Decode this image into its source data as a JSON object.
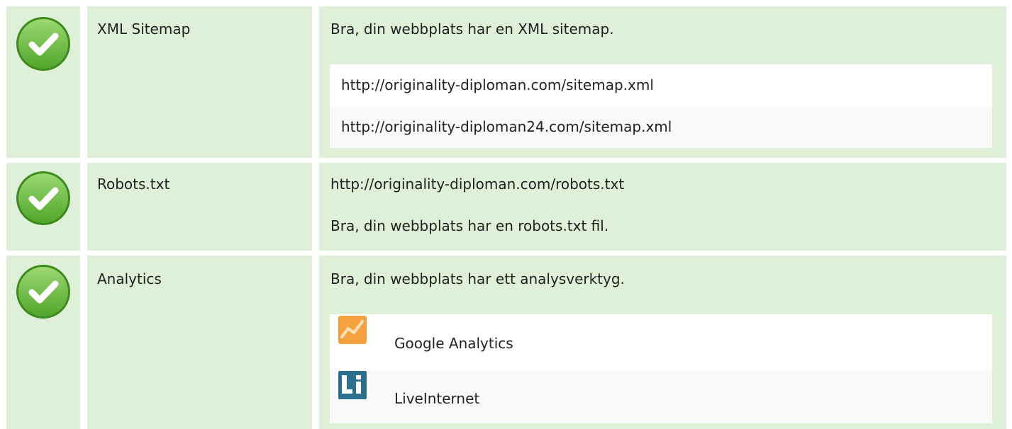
{
  "rows": [
    {
      "label": "XML Sitemap",
      "message": "Bra, din webbplats har en XML sitemap.",
      "links": [
        "http://originality-diploman.com/sitemap.xml",
        "http://originality-diploman24.com/sitemap.xml"
      ]
    },
    {
      "label": "Robots.txt",
      "link": "http://originality-diploman.com/robots.txt",
      "message": "Bra, din webbplats har en robots.txt fil."
    },
    {
      "label": "Analytics",
      "message": "Bra, din webbplats har ett analysverktyg.",
      "tools": [
        {
          "name": "Google Analytics",
          "icon": "google-analytics-icon"
        },
        {
          "name": "LiveInternet",
          "icon": "liveinternet-icon"
        }
      ]
    }
  ],
  "colors": {
    "row_bg": "#dff0d8",
    "check_green": "#5cb85c",
    "subtable_odd": "#ffffff",
    "subtable_even": "#f9f9f9",
    "ga_orange": "#f6a140",
    "li_blue": "#2f6f8e"
  }
}
